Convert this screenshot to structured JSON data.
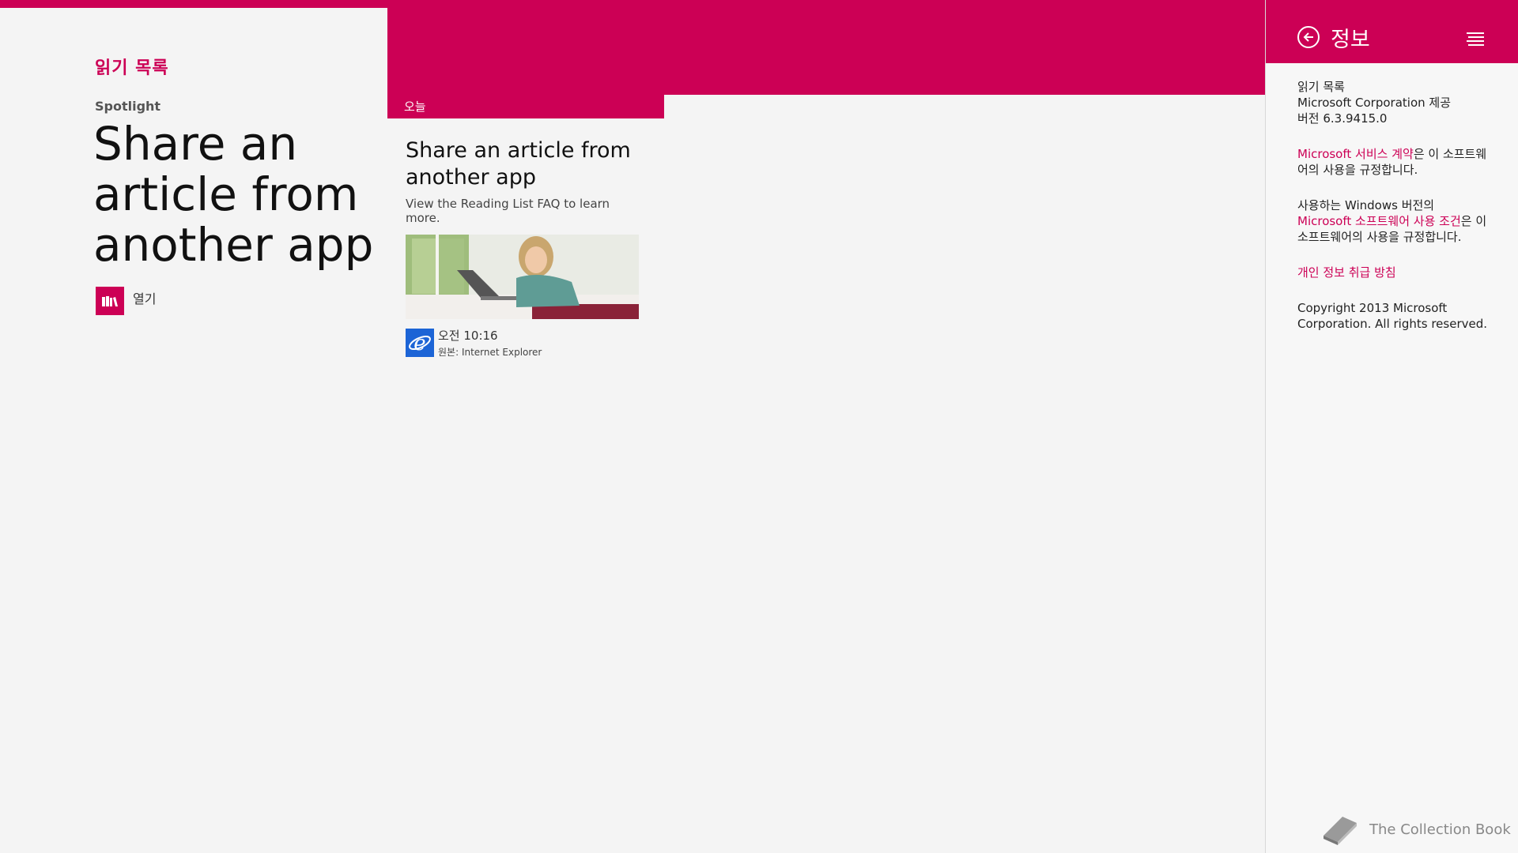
{
  "app": {
    "title": "읽기 목록",
    "accent_color": "#cc0055"
  },
  "spotlight": {
    "label": "Spotlight",
    "headline": "Share an article from another app",
    "open_label": "열기",
    "open_icon": "books-icon"
  },
  "group": {
    "label": "오늘"
  },
  "card": {
    "title": "Share an article from another app",
    "description": "View the Reading List FAQ to learn more.",
    "image": "woman-laptop-photo",
    "time": "오전 10:16",
    "source": "원본: Internet Explorer",
    "source_icon": "internet-explorer-icon"
  },
  "panel": {
    "title": "정보",
    "back_icon": "back-arrow-icon",
    "settings_icon": "settings-lines-icon",
    "app_name": "읽기 목록",
    "publisher": "Microsoft Corporation 제공",
    "version": "버전 6.3.9415.0",
    "terms_link": "Microsoft 서비스 계약",
    "terms_text": "은 이 소프트웨어의 사용을 규정합니다.",
    "windows_text_1": "사용하는 Windows 버전의",
    "software_terms_link": "Microsoft 소프트웨어 사용 조건",
    "windows_text_2": "은 이 소프트웨어의 사용을 규정합니다.",
    "privacy_link": "개인 정보 취급 방침",
    "copyright": "Copyright 2013 Microsoft Corporation. All rights reserved."
  },
  "watermark": {
    "text": "The Collection Book",
    "icon": "book-icon"
  }
}
